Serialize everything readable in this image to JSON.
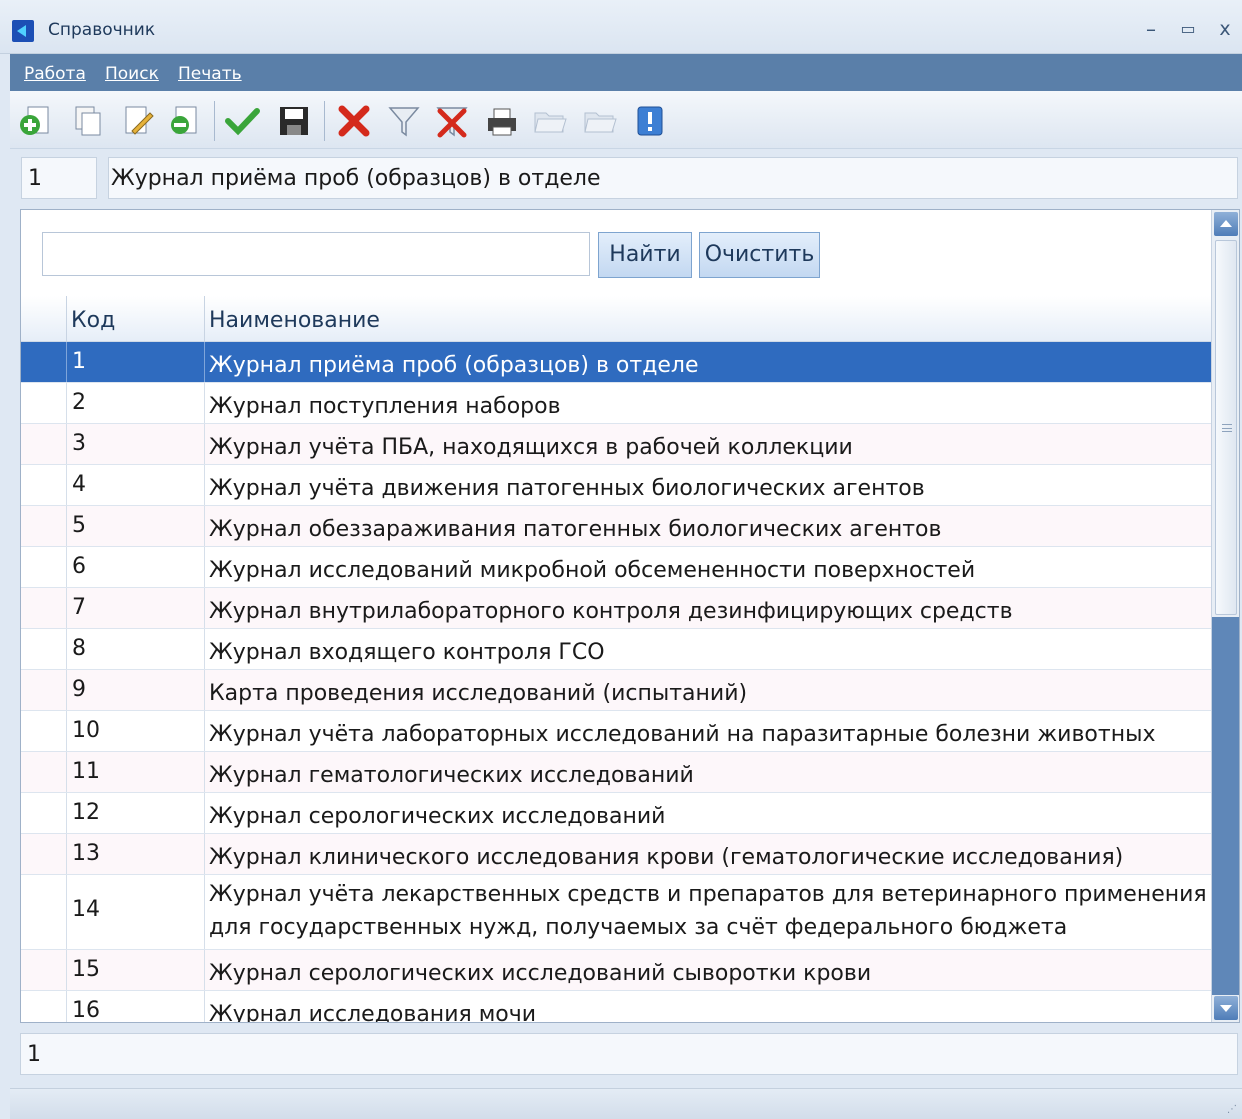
{
  "window": {
    "title": "Справочник",
    "min": "–",
    "max": "▭",
    "close": "x"
  },
  "menu": [
    "Работа",
    "Поиск",
    "Печать"
  ],
  "toolbar_icons": [
    "add-icon",
    "copy-icon",
    "edit-icon",
    "delete-row-icon",
    "check-icon",
    "save-icon",
    "cancel-icon",
    "filter-icon",
    "clear-filter-icon",
    "print-icon",
    "folder-open-icon",
    "folder-save-icon",
    "info-icon"
  ],
  "header": {
    "code": "1",
    "name": "Журнал приёма проб (образцов) в отделе"
  },
  "search": {
    "value": "",
    "placeholder": "",
    "find_label": "Найти",
    "clear_label": "Очистить"
  },
  "columns": {
    "code": "Код",
    "name": "Наименование"
  },
  "rows": [
    {
      "code": "1",
      "name": "Журнал приёма проб (образцов) в отделе"
    },
    {
      "code": "2",
      "name": "Журнал поступления наборов"
    },
    {
      "code": "3",
      "name": "Журнал учёта ПБА, находящихся в рабочей коллекции"
    },
    {
      "code": "4",
      "name": "Журнал учёта движения патогенных биологических агентов"
    },
    {
      "code": "5",
      "name": "Журнал обеззараживания патогенных биологических агентов"
    },
    {
      "code": "6",
      "name": "Журнал исследований микробной обсемененности поверхностей"
    },
    {
      "code": "7",
      "name": "Журнал внутрилабораторного контроля дезинфицирующих средств"
    },
    {
      "code": "8",
      "name": "Журнал входящего контроля ГСО"
    },
    {
      "code": "9",
      "name": "Карта проведения исследований (испытаний)"
    },
    {
      "code": "10",
      "name": "Журнал учёта лабораторных исследований на паразитарные болезни животных"
    },
    {
      "code": "11",
      "name": "Журнал гематологических исследований"
    },
    {
      "code": "12",
      "name": "Журнал серологических исследований"
    },
    {
      "code": "13",
      "name": "Журнал клинического исследования крови (гематологические исследования)"
    },
    {
      "code": "14",
      "name": "Журнал учёта лекарственных средств и препаратов для ветеринарного применения\nдля государственных нужд, получаемых за счёт федерального бюджета"
    },
    {
      "code": "15",
      "name": "Журнал серологических исследований сыворотки крови"
    },
    {
      "code": "16",
      "name": "Журнал исследования мочи"
    }
  ],
  "footer": {
    "value": "1"
  },
  "colors": {
    "selection": "#2f6bbf",
    "menubar": "#5a7fa9"
  }
}
